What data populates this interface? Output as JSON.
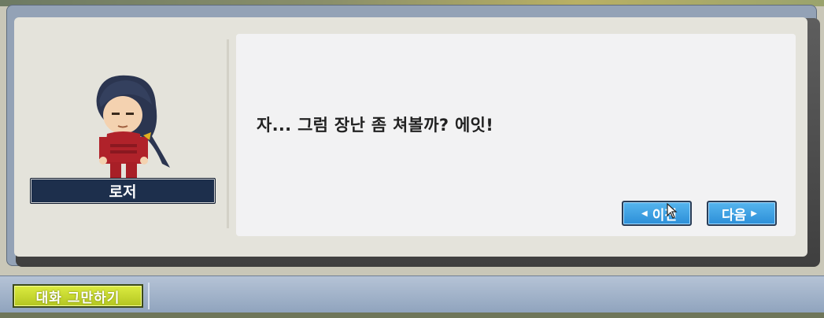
{
  "npc": {
    "name": "로저"
  },
  "dialog": {
    "message": "자... 그럼 장난 좀 쳐볼까? 에잇!",
    "prev_label": "이전",
    "next_label": "다음"
  },
  "bottom": {
    "quit_label": "대화 그만하기"
  },
  "colors": {
    "nav_button": "#3ea2e6",
    "quit_button": "#c8d830",
    "name_plate": "#1d2f4c"
  }
}
